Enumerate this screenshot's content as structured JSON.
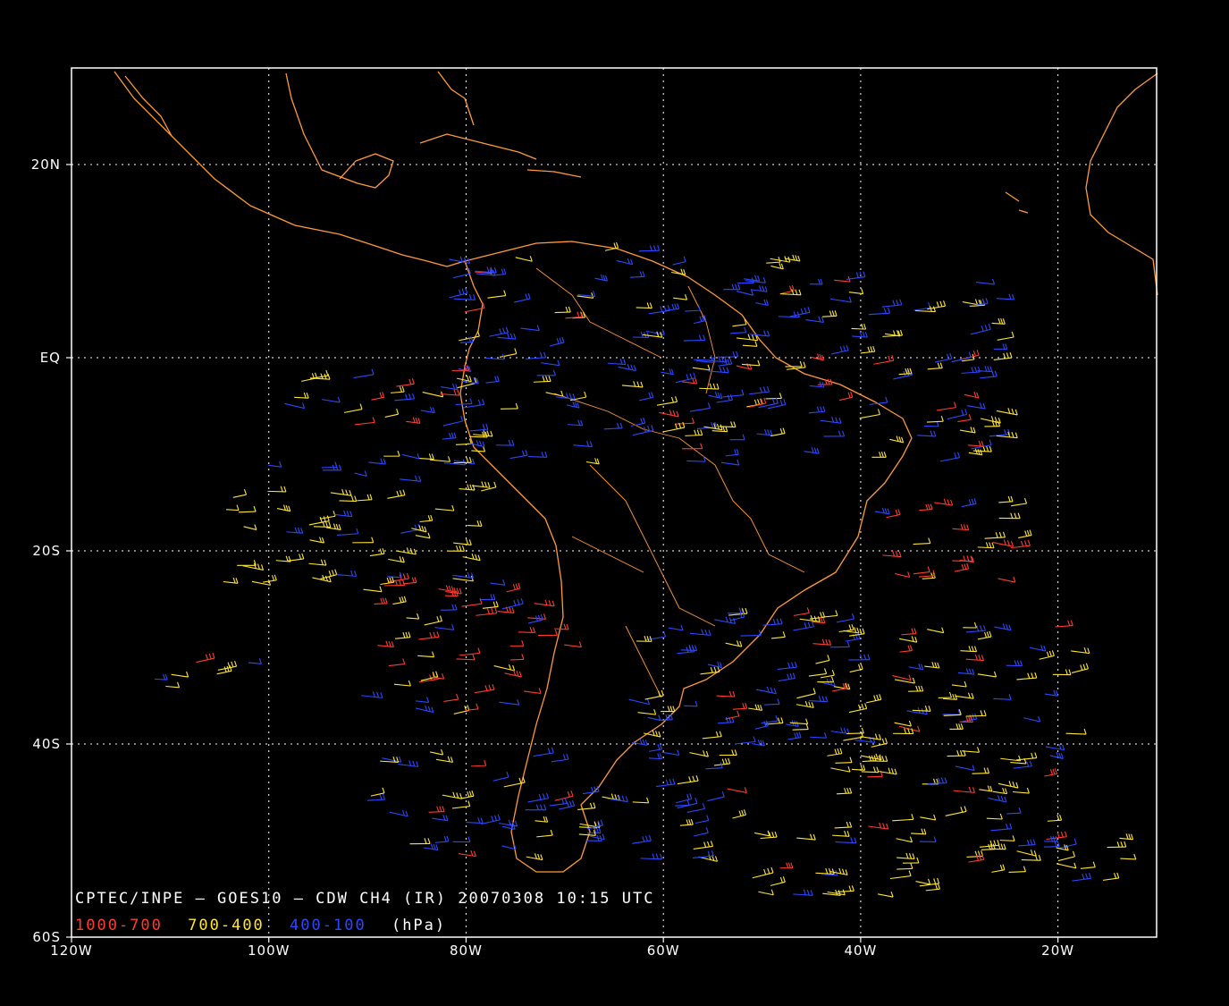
{
  "title": "CPTEC/INPE — GOES10 — CDW CH4 (IR) 20070308 10:15 UTC",
  "legend": {
    "items": [
      {
        "label": "1000-700",
        "color": "#ff3b2f"
      },
      {
        "label": "700-400",
        "color": "#ffe633"
      },
      {
        "label": "400-100",
        "color": "#2b48ff"
      }
    ],
    "unit": "(hPa)"
  },
  "axes": {
    "lon_range": [
      -120,
      -10
    ],
    "lat_range": [
      -60,
      30
    ],
    "x_ticks": [
      {
        "value": -120,
        "label": "120W"
      },
      {
        "value": -100,
        "label": "100W"
      },
      {
        "value": -80,
        "label": "80W"
      },
      {
        "value": -60,
        "label": "60W"
      },
      {
        "value": -40,
        "label": "40W"
      },
      {
        "value": -20,
        "label": "20W"
      }
    ],
    "y_ticks": [
      {
        "value": 20,
        "label": "20N"
      },
      {
        "value": 0,
        "label": "EQ"
      },
      {
        "value": -20,
        "label": "20S"
      },
      {
        "value": -40,
        "label": "40S"
      },
      {
        "value": -60,
        "label": "60S"
      }
    ],
    "grid": true
  },
  "colors": {
    "coast": "#ff9a3c",
    "frame": "#ffffff",
    "grid": "#ffffff"
  }
}
